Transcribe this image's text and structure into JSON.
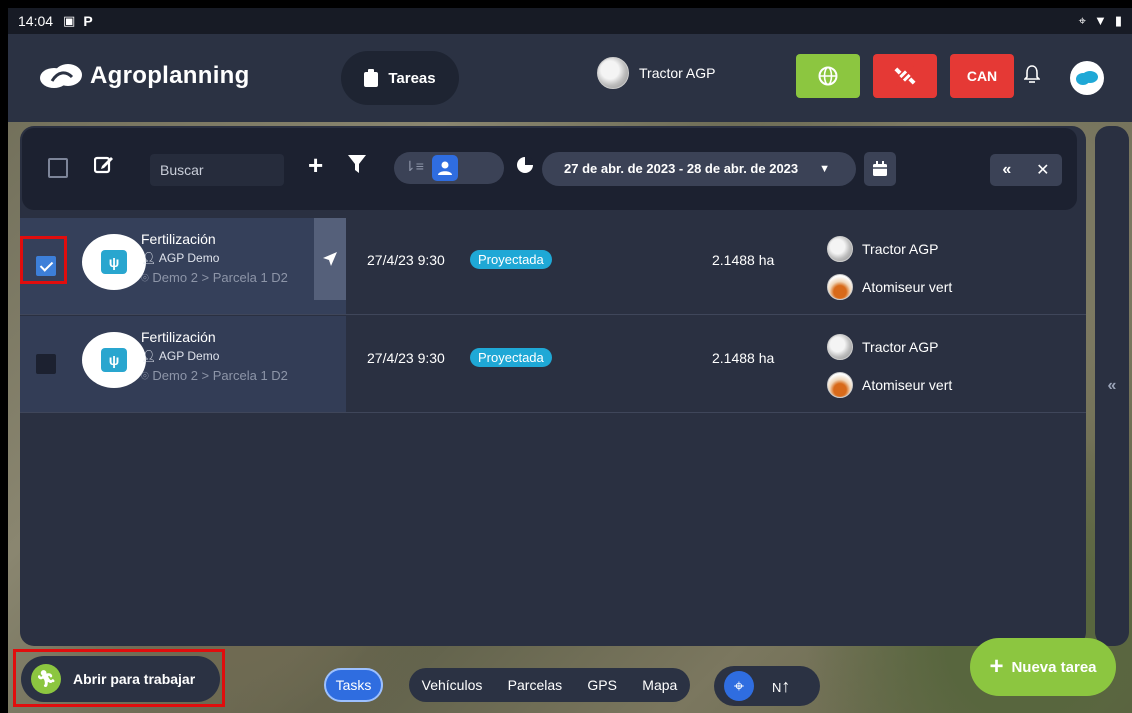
{
  "status_bar": {
    "time": "14:04",
    "notification_icons": [
      "image-icon",
      "p-icon"
    ],
    "system_icons": [
      "location-icon",
      "wifi-icon",
      "battery-icon"
    ]
  },
  "header": {
    "brand": "Agroplanning",
    "tasks_button": "Tareas",
    "vehicle_name": "Tractor AGP",
    "can_label": "CAN",
    "colors": {
      "green": "#8cc640",
      "red": "#e53935",
      "blue": "#2f6de0"
    }
  },
  "toolbar": {
    "search_placeholder": "Buscar",
    "date_range": "27 de abr. de 2023 - 28 de abr. de 2023"
  },
  "tasks": [
    {
      "title": "Fertilización",
      "user": "AGP Demo",
      "location": "Demo 2 > Parcela 1 D2",
      "date": "27/4/23 9:30",
      "status": "Proyectada",
      "area": "2.1488 ha",
      "resources": [
        "Tractor AGP",
        "Atomiseur vert"
      ],
      "checked": true
    },
    {
      "title": "Fertilización",
      "user": "AGP Demo",
      "location": "Demo 2 > Parcela 1 D2",
      "date": "27/4/23 9:30",
      "status": "Proyectada",
      "area": "2.1488 ha",
      "resources": [
        "Tractor AGP",
        "Atomiseur vert"
      ],
      "checked": false
    }
  ],
  "bottom_bar": {
    "open_to_work": "Abrir para trabajar",
    "tabs": [
      "Tasks",
      "Vehículos",
      "Parcelas",
      "GPS",
      "Mapa"
    ],
    "compass_label": "N",
    "new_task": "Nueva tarea"
  }
}
